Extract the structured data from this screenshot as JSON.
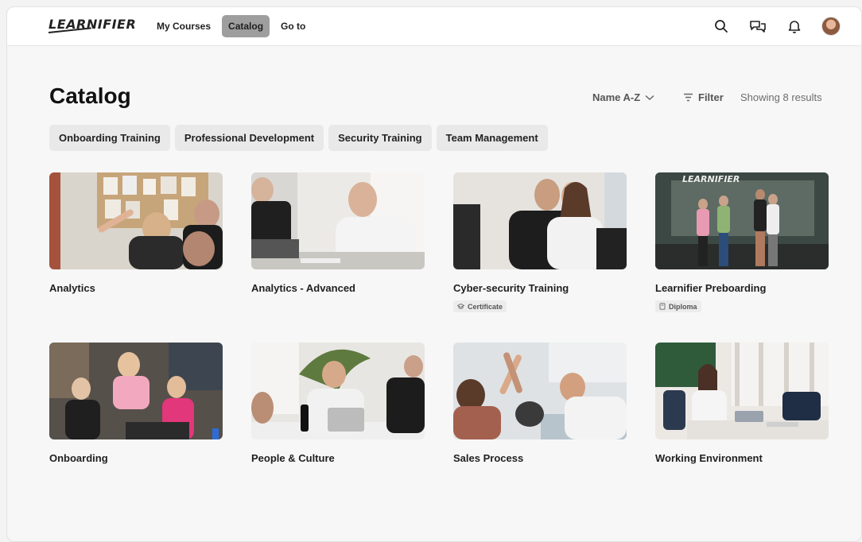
{
  "header": {
    "logo_text": "LEARNIFIER",
    "nav": [
      {
        "label": "My Courses",
        "active": false
      },
      {
        "label": "Catalog",
        "active": true
      },
      {
        "label": "Go to",
        "active": false
      }
    ],
    "icons": [
      "search-icon",
      "chat-icon",
      "bell-icon",
      "avatar"
    ]
  },
  "page": {
    "title": "Catalog",
    "sort_label": "Name A-Z",
    "filter_label": "Filter",
    "results_text": "Showing 8 results"
  },
  "categories": [
    "Onboarding Training",
    "Professional Development",
    "Security Training",
    "Team Management"
  ],
  "courses": [
    {
      "title": "Analytics",
      "badge": ""
    },
    {
      "title": "Analytics - Advanced",
      "badge": ""
    },
    {
      "title": "Cyber-security Training",
      "badge": "Certificate"
    },
    {
      "title": "Learnifier Preboarding",
      "badge": "Diploma"
    },
    {
      "title": "Onboarding",
      "badge": ""
    },
    {
      "title": "People & Culture",
      "badge": ""
    },
    {
      "title": "Sales Process",
      "badge": ""
    },
    {
      "title": "Working Environment",
      "badge": ""
    }
  ],
  "thumb_logo_text": "LEARNIFIER",
  "colors": {
    "active_nav": "#9e9e9e",
    "chip_bg": "#e9e9e9",
    "page_bg": "#f7f7f7"
  }
}
